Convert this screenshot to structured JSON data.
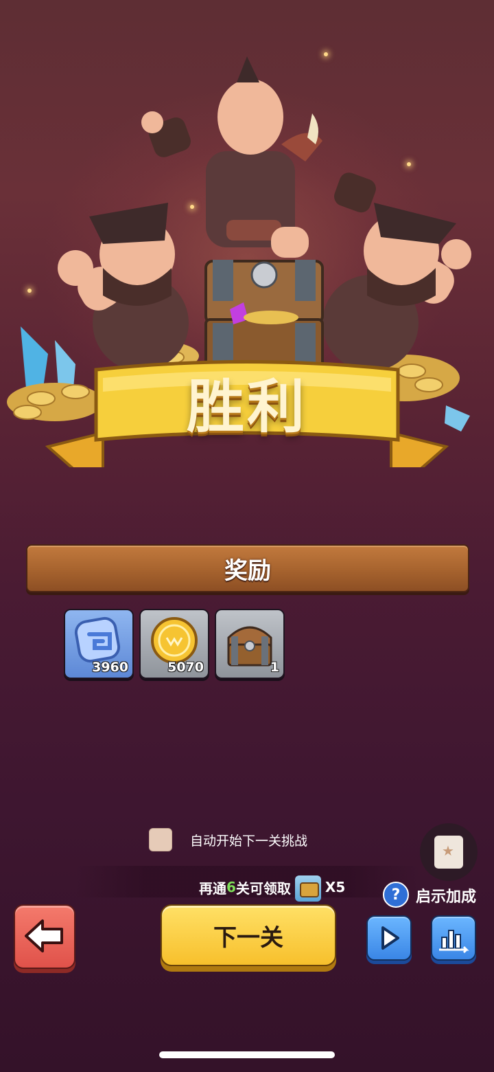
{
  "result": {
    "title": "胜利"
  },
  "rewards": {
    "header": "奖励",
    "items": [
      {
        "icon": "scroll-token-icon",
        "count": "3960"
      },
      {
        "icon": "gold-coin-icon",
        "count": "5070"
      },
      {
        "icon": "treasure-chest-icon",
        "count": "1"
      }
    ]
  },
  "auto_next": {
    "label": "自动开始下一关挑战",
    "checked": false
  },
  "progress": {
    "prefix": "再通",
    "number": "6",
    "suffix": "关可领取",
    "reward_icon": "chest-reward-icon",
    "multiplier": "X5"
  },
  "hint_bonus": {
    "label": "启示加成",
    "help": "?"
  },
  "buttons": {
    "next_label": "下一关"
  },
  "colors": {
    "accent_yellow": "#f7c02c",
    "back_red": "#e0524a",
    "blue_button": "#3a86e6",
    "progress_green": "#7fe05a"
  }
}
